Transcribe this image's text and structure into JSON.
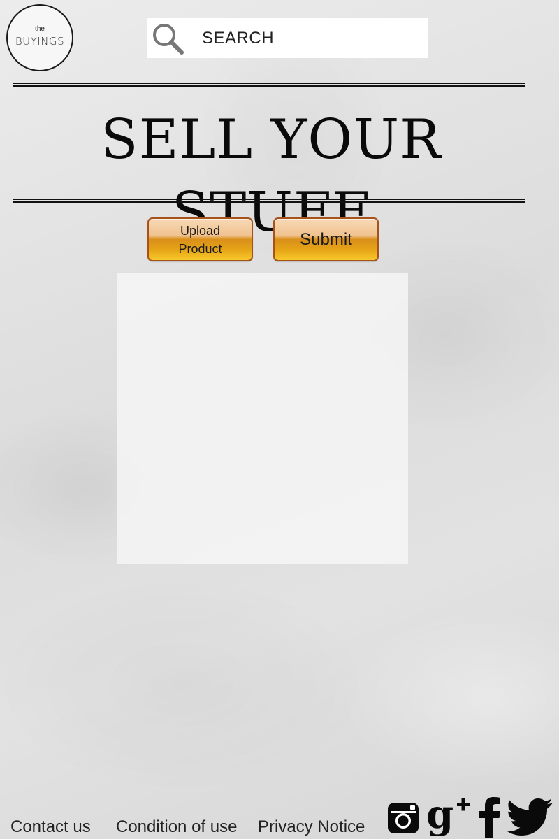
{
  "logo": {
    "small_text": "the",
    "brand_text": "BUYINGS"
  },
  "search": {
    "placeholder": "SEARCH",
    "icon": "search-icon"
  },
  "page": {
    "title": "SELL YOUR STUFF"
  },
  "actions": {
    "upload_label": "Upload Product",
    "submit_label": "Submit"
  },
  "footer": {
    "links": [
      "Contact us",
      "Condition of use",
      "Privacy Notice"
    ],
    "social_icons": [
      "instagram-icon",
      "google-plus-icon",
      "facebook-icon",
      "twitter-icon"
    ]
  },
  "colors": {
    "button_gold": "#e6a417",
    "button_border": "#a6521a",
    "text": "#111111"
  }
}
